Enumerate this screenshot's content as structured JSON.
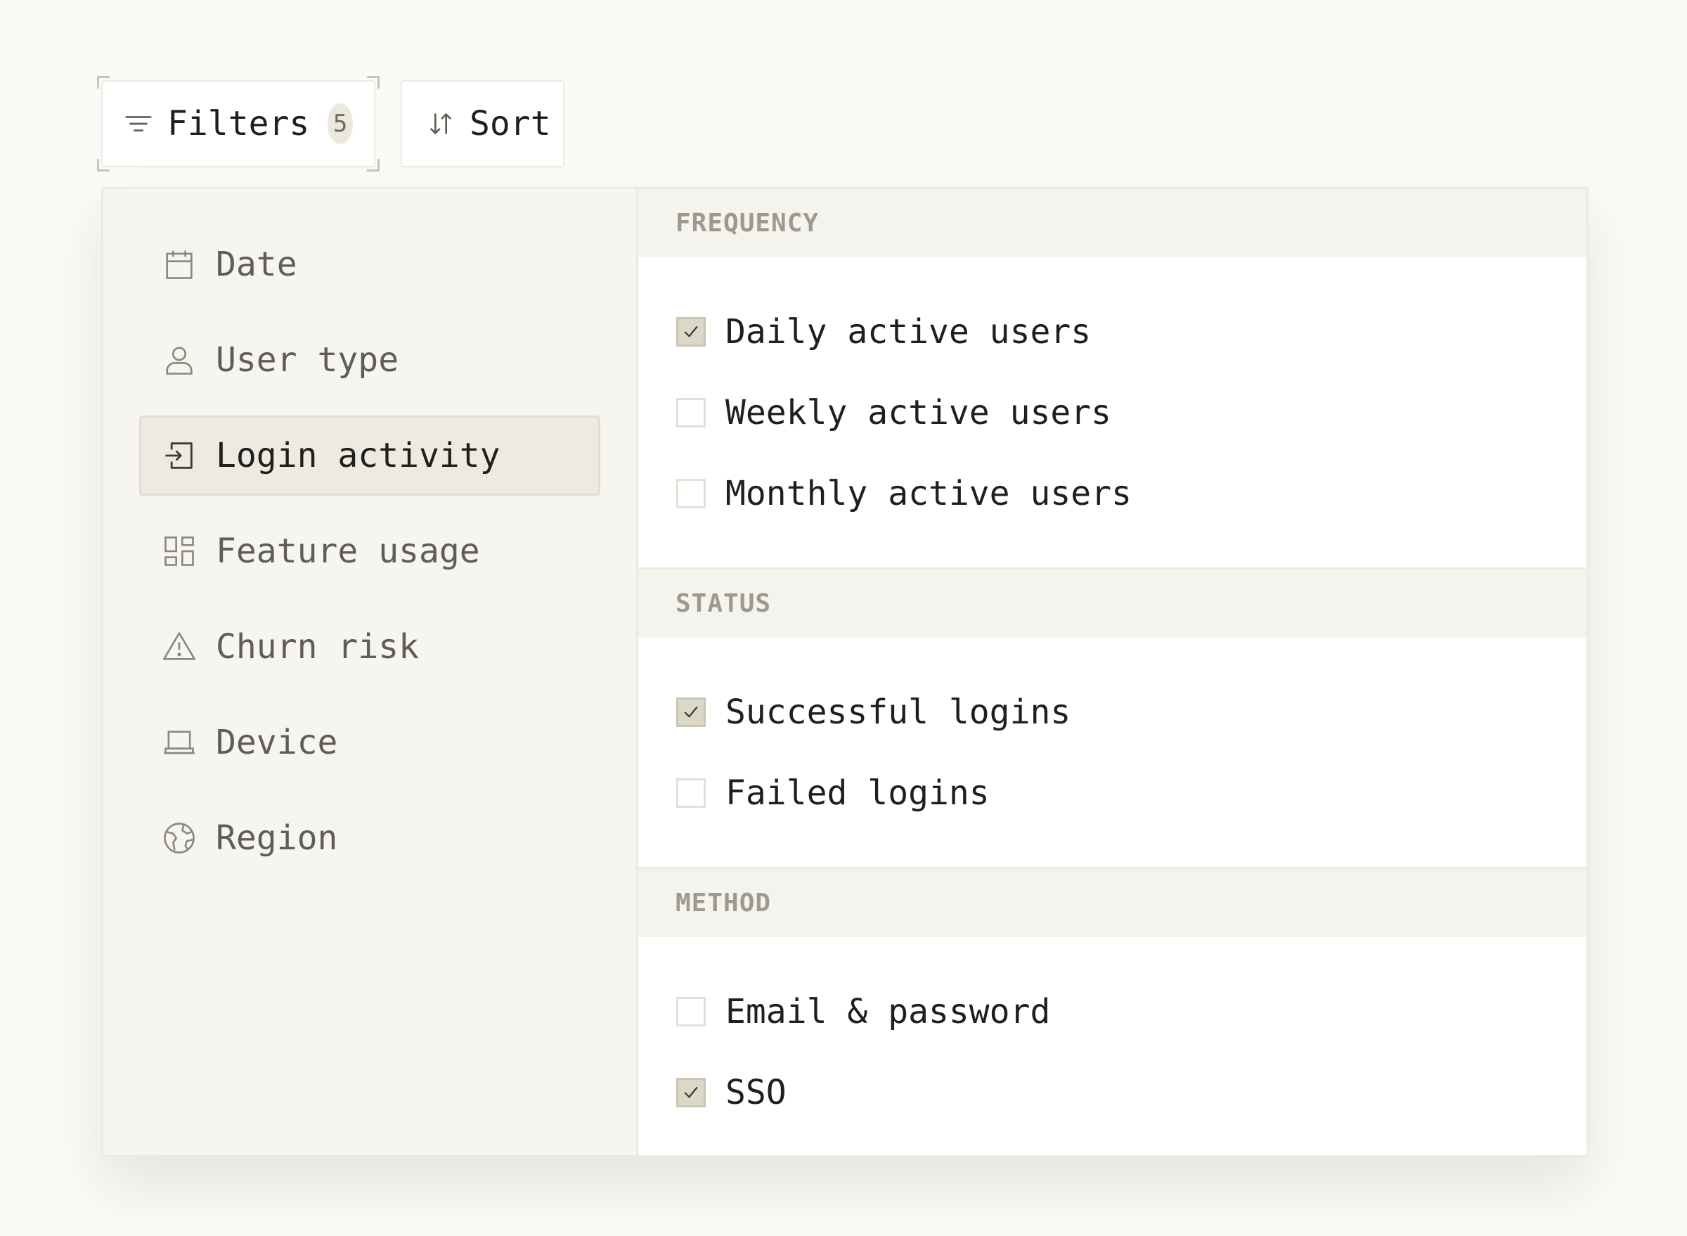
{
  "toolbar": {
    "filters": {
      "label": "Filters",
      "count": "5",
      "icon": "filter-lines-icon"
    },
    "sort": {
      "label": "Sort",
      "icon": "sort-arrows-icon"
    }
  },
  "sidebar": {
    "items": [
      {
        "label": "Date",
        "icon": "calendar-icon",
        "active": false
      },
      {
        "label": "User type",
        "icon": "user-icon",
        "active": false
      },
      {
        "label": "Login activity",
        "icon": "login-icon",
        "active": true
      },
      {
        "label": "Feature usage",
        "icon": "grid-icon",
        "active": false
      },
      {
        "label": "Churn risk",
        "icon": "warning-icon",
        "active": false
      },
      {
        "label": "Device",
        "icon": "laptop-icon",
        "active": false
      },
      {
        "label": "Region",
        "icon": "globe-icon",
        "active": false
      }
    ]
  },
  "sections": [
    {
      "title": "FREQUENCY",
      "options": [
        {
          "label": "Daily active users",
          "checked": true
        },
        {
          "label": "Weekly active users",
          "checked": false
        },
        {
          "label": "Monthly active users",
          "checked": false
        }
      ]
    },
    {
      "title": "STATUS",
      "options": [
        {
          "label": "Successful logins",
          "checked": true
        },
        {
          "label": "Failed logins",
          "checked": false
        }
      ]
    },
    {
      "title": "METHOD",
      "options": [
        {
          "label": "Email & password",
          "checked": false
        },
        {
          "label": "SSO",
          "checked": true
        }
      ]
    }
  ],
  "colors": {
    "background": "#fafaf6",
    "sidebar": "#f6f5ef",
    "active_item": "#edebe1",
    "checkbox_checked": "#dcd8c8",
    "section_header_text": "#9d9a8d"
  }
}
